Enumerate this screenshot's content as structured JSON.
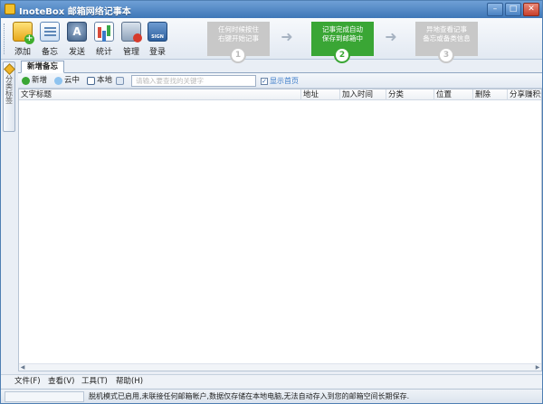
{
  "window": {
    "title": "InoteBox 邮箱网络记事本",
    "minimize": "–",
    "maximize": "□",
    "close": "✕"
  },
  "toolbar": {
    "items": [
      {
        "label": "添加",
        "icon": "add-note-icon"
      },
      {
        "label": "备忘",
        "icon": "memo-icon"
      },
      {
        "label": "发送",
        "icon": "send-icon"
      },
      {
        "label": "统计",
        "icon": "stats-icon"
      },
      {
        "label": "管理",
        "icon": "manage-icon"
      },
      {
        "label": "登录",
        "icon": "login-icon"
      }
    ]
  },
  "guide": {
    "steps": [
      {
        "line1": "任何时候按住",
        "line2": "右键开始记事",
        "num": "1",
        "state": "inactive"
      },
      {
        "line1": "记事完成自动",
        "line2": "保存到邮箱中",
        "num": "2",
        "state": "active"
      },
      {
        "line1": "异地查看记事",
        "line2": "备忘或备类信息",
        "num": "3",
        "state": "inactive"
      }
    ],
    "arrow": "➜"
  },
  "sidepanel": {
    "tab_label": "分类标签"
  },
  "tabs": {
    "active": "新增备忘"
  },
  "subbar": {
    "new": "新增",
    "cloud": "云中",
    "local": "本地",
    "search_placeholder": "请输入要查找的关键字",
    "show_home": "显示首页",
    "show_home_checked": true
  },
  "table": {
    "columns": [
      "文字标题",
      "地址",
      "加入时间",
      "分类",
      "位置",
      "删除",
      "分享赚积分"
    ],
    "rows": []
  },
  "menubar": {
    "items": [
      "文件(F)",
      "查看(V)",
      "工具(T)",
      "帮助(H)"
    ]
  },
  "status": {
    "text": "脱机模式已启用,未联接任何邮箱帐户,数据仅存储在本地电脑,无法自动存入到您的邮箱空间长期保存."
  }
}
